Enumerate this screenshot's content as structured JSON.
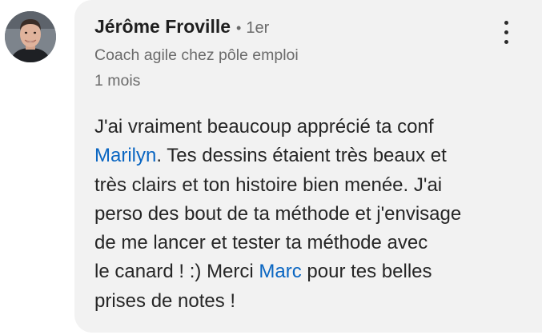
{
  "author": {
    "name": "Jérôme Froville",
    "separator": "•",
    "connection_degree": "1er",
    "headline": "Coach agile chez pôle emploi",
    "timestamp": "1 mois"
  },
  "comment": {
    "line1": "J'ai vraiment beaucoup apprécié ta conf",
    "mention1": "Marilyn",
    "line2_rest": ". Tes dessins étaient très beaux et",
    "line3": "très clairs et ton histoire bien menée. J'ai",
    "line4": "perso des bout de ta méthode et j'envisage",
    "line5": "de me lancer et tester ta méthode avec",
    "line6_start": "le canard ! :) Merci ",
    "mention2": "Marc",
    "line6_rest": " pour tes belles",
    "line7": "prises de notes !"
  },
  "colors": {
    "mention": "#0a66c2",
    "bubble_background": "#f2f2f2",
    "secondary_text": "#6b6b6b"
  },
  "icons": {
    "menu": "more-vertical-icon",
    "avatar": "profile-photo"
  }
}
